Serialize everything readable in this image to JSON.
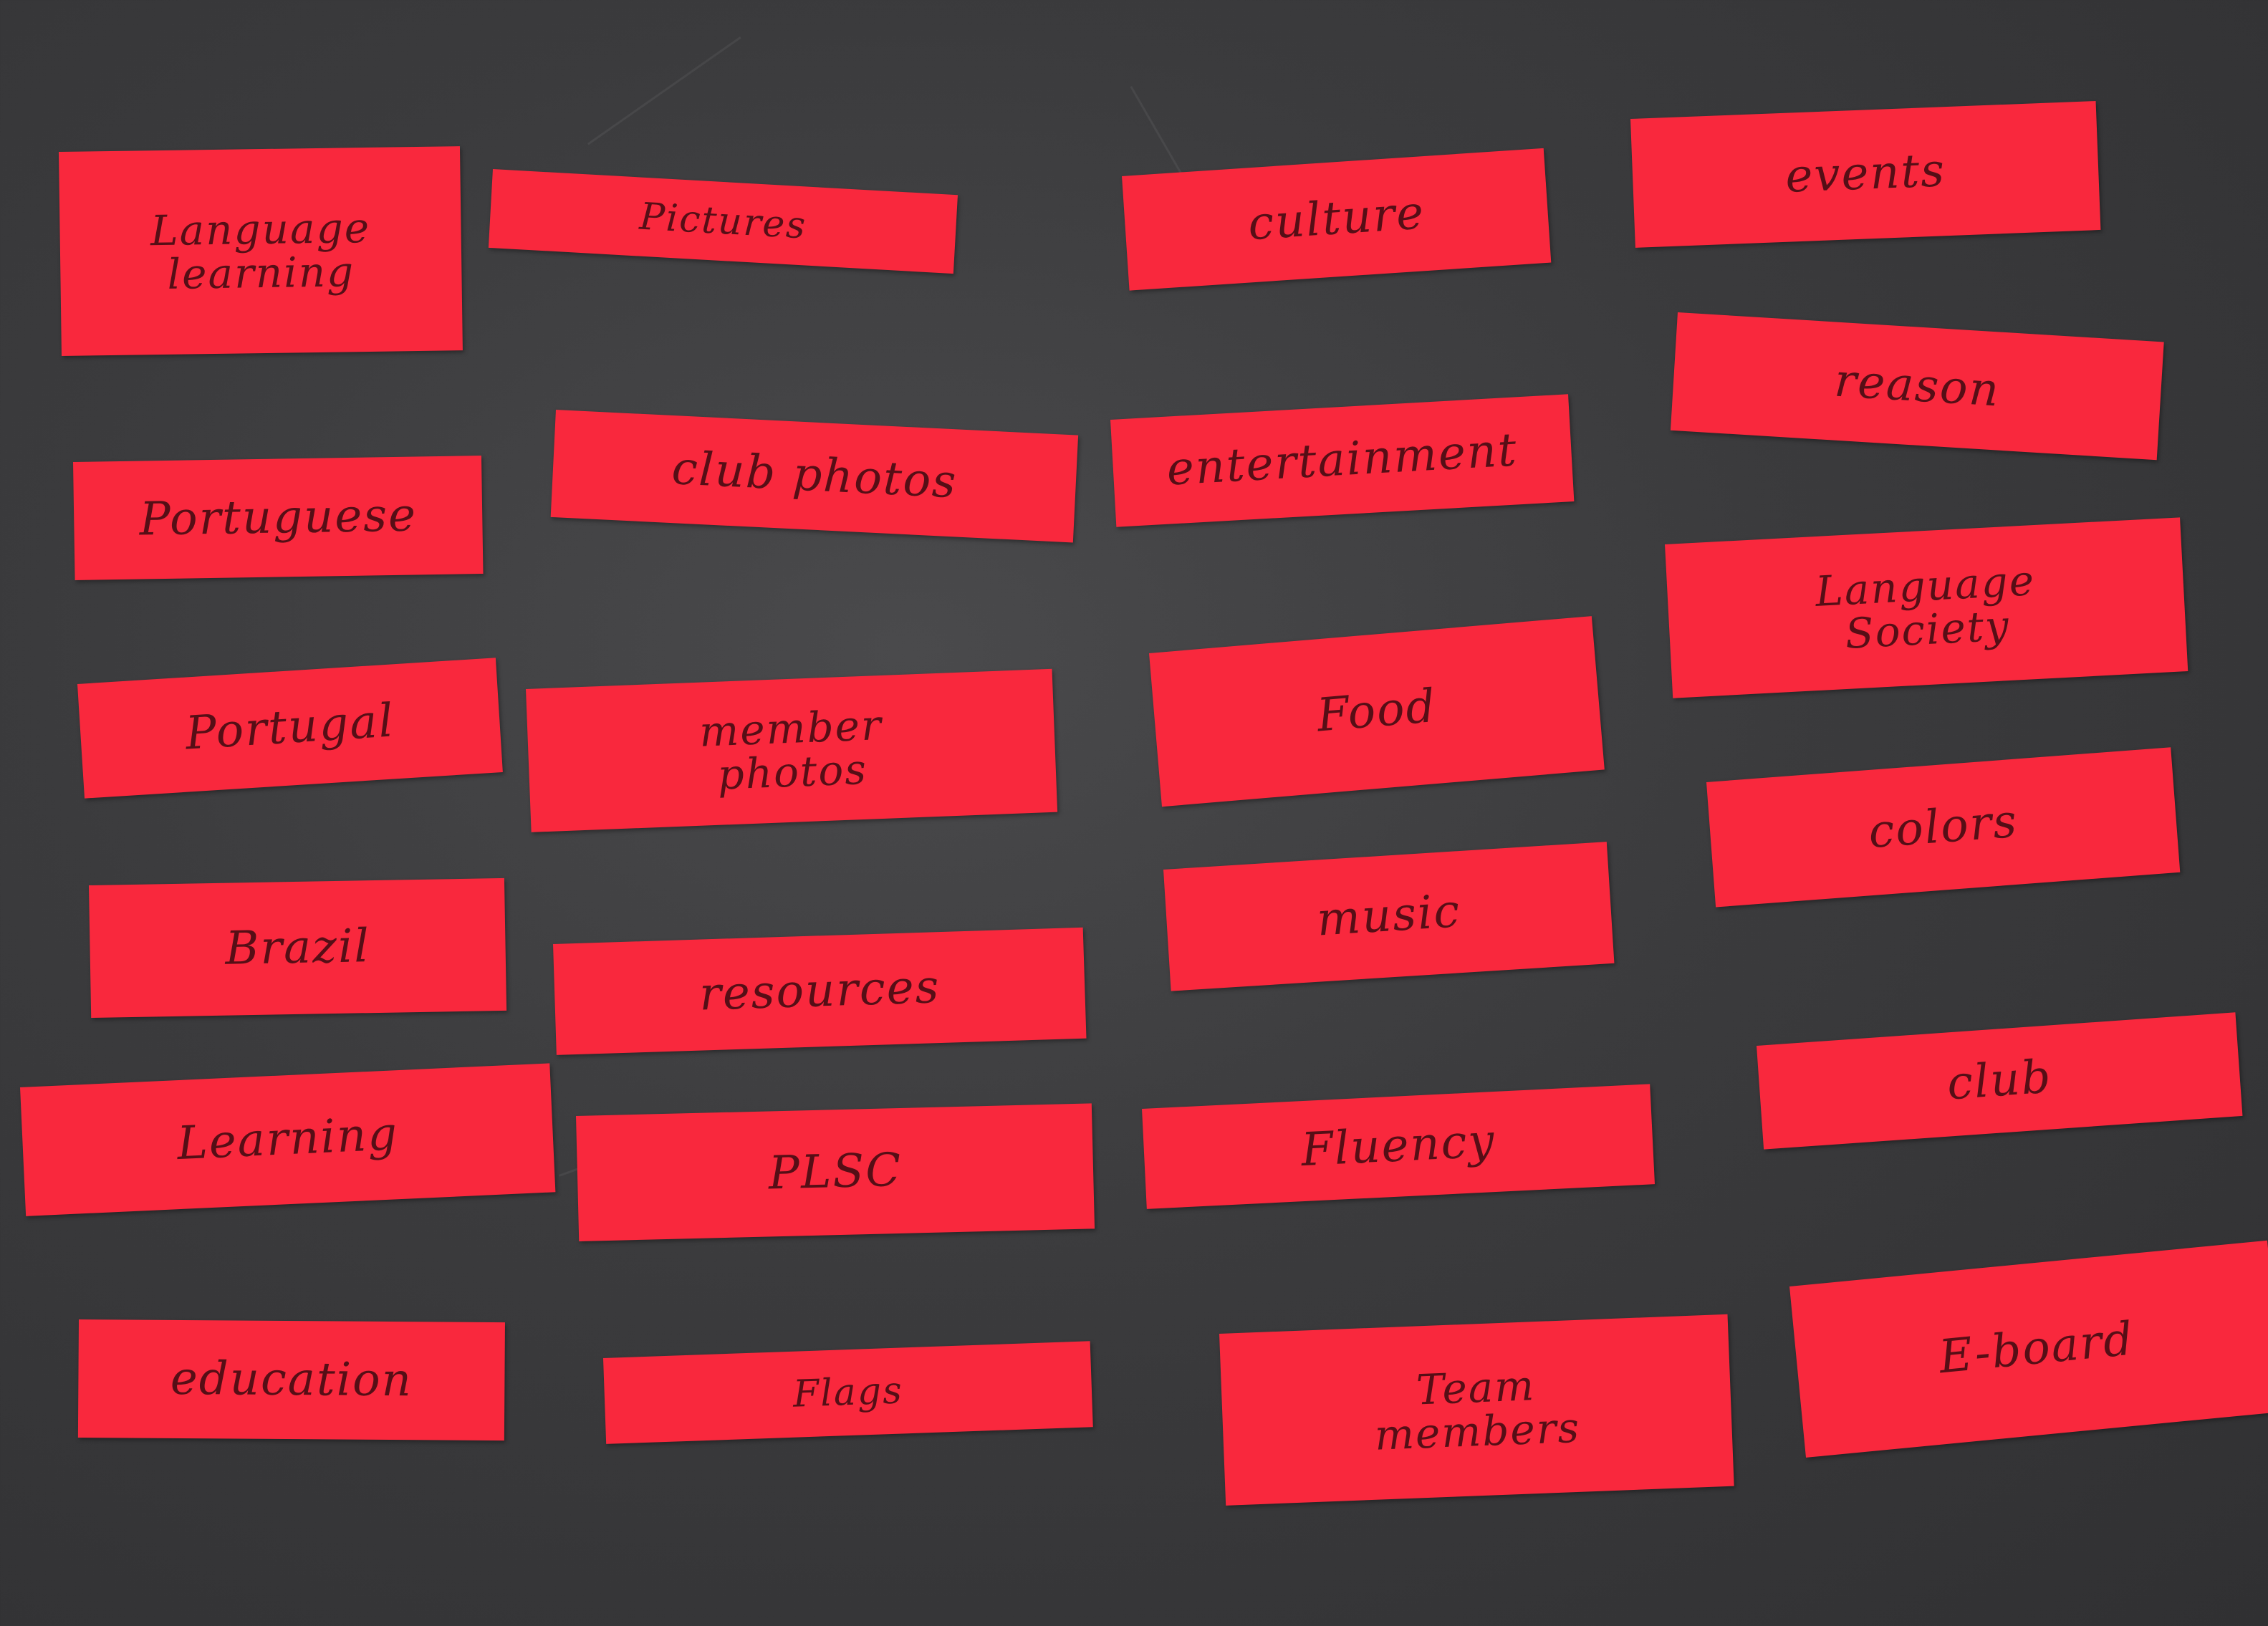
{
  "cards": [
    {
      "id": "language-learning",
      "text": "Language\nlearning"
    },
    {
      "id": "pictures",
      "text": "Pictures"
    },
    {
      "id": "culture",
      "text": "culture"
    },
    {
      "id": "events",
      "text": "events"
    },
    {
      "id": "portuguese",
      "text": "Portuguese"
    },
    {
      "id": "club-photos",
      "text": "club photos"
    },
    {
      "id": "entertainment",
      "text": "entertainment"
    },
    {
      "id": "reason",
      "text": "reason"
    },
    {
      "id": "language-society",
      "text": "Language\nSociety"
    },
    {
      "id": "portugal",
      "text": "Portugal"
    },
    {
      "id": "member-photos",
      "text": "member\nphotos"
    },
    {
      "id": "food",
      "text": "Food"
    },
    {
      "id": "colors",
      "text": "colors"
    },
    {
      "id": "brazil",
      "text": "Brazil"
    },
    {
      "id": "resources",
      "text": "resources"
    },
    {
      "id": "music",
      "text": "music"
    },
    {
      "id": "club",
      "text": "club"
    },
    {
      "id": "learning",
      "text": "Learning"
    },
    {
      "id": "plsc",
      "text": "PLSC"
    },
    {
      "id": "fluency",
      "text": "Fluency"
    },
    {
      "id": "education",
      "text": "education"
    },
    {
      "id": "flags",
      "text": "Flags"
    },
    {
      "id": "team-members",
      "text": "Team\nmembers"
    },
    {
      "id": "e-board",
      "text": "E-board"
    }
  ]
}
